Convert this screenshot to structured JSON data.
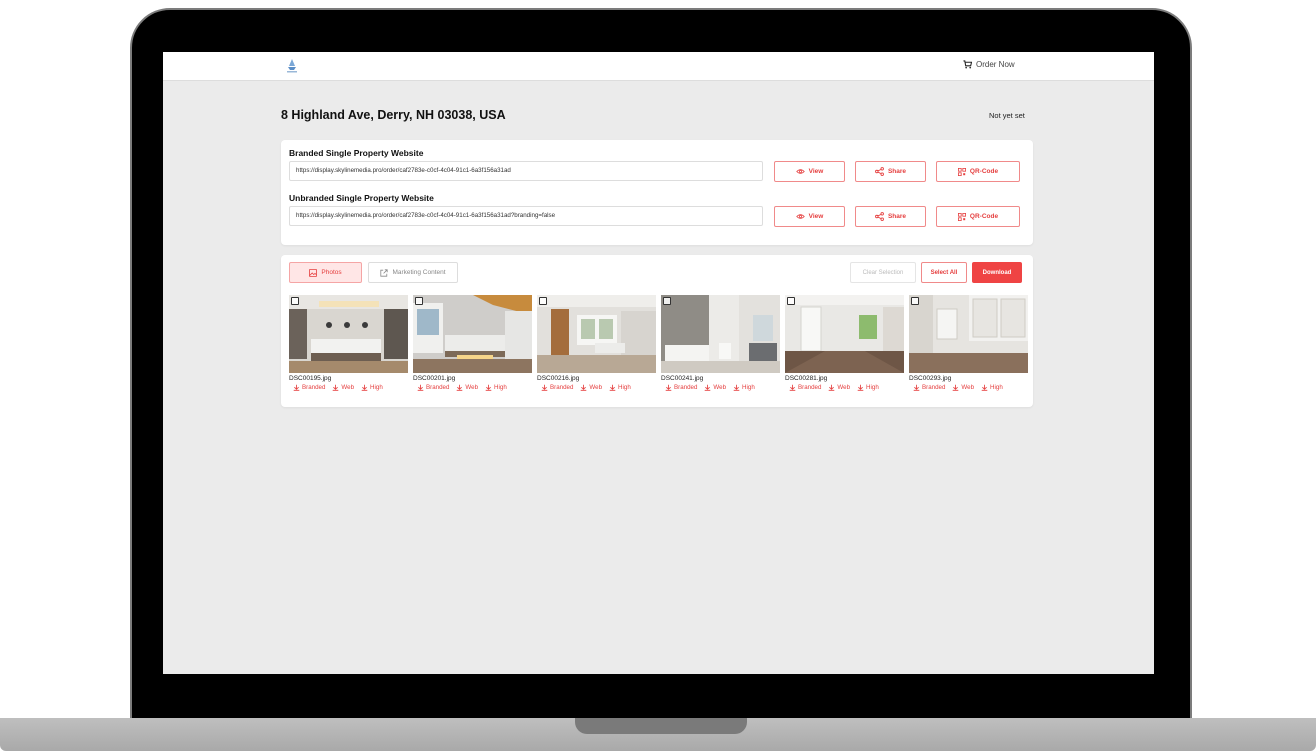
{
  "nav": {
    "order_now": "Order Now"
  },
  "property": {
    "address": "8 Highland Ave, Derry, NH 03038, USA",
    "status": "Not yet set"
  },
  "links": [
    {
      "title": "Branded Single Property Website",
      "url": "https://display.skylinemedia.pro/order/caf2783e-c0cf-4c04-91c1-6a3f156a31ad",
      "view": "View",
      "share": "Share",
      "qr": "QR-Code"
    },
    {
      "title": "Unbranded Single Property Website",
      "url": "https://display.skylinemedia.pro/order/caf2783e-c0cf-4c04-91c1-6a3f156a31ad?branding=false",
      "view": "View",
      "share": "Share",
      "qr": "QR-Code"
    }
  ],
  "gallery": {
    "tab_photos": "Photos",
    "tab_marketing": "Marketing Content",
    "clear_selection": "Clear Selection",
    "select_all": "Select All",
    "download": "Download",
    "photos": [
      {
        "filename": "DSC00195.jpg",
        "branded": "Branded",
        "web": "Web",
        "high": "High"
      },
      {
        "filename": "DSC00201.jpg",
        "branded": "Branded",
        "web": "Web",
        "high": "High"
      },
      {
        "filename": "DSC00216.jpg",
        "branded": "Branded",
        "web": "Web",
        "high": "High"
      },
      {
        "filename": "DSC00241.jpg",
        "branded": "Branded",
        "web": "Web",
        "high": "High"
      },
      {
        "filename": "DSC00281.jpg",
        "branded": "Branded",
        "web": "Web",
        "high": "High"
      },
      {
        "filename": "DSC00293.jpg",
        "branded": "Branded",
        "web": "Web",
        "high": "High"
      }
    ]
  },
  "colors": {
    "accent": "#ef4444",
    "page_bg": "#ebebeb"
  },
  "icons": [
    "shopping-cart-icon",
    "eye-icon",
    "share-icon",
    "qr-code-icon",
    "image-icon",
    "external-link-icon",
    "download-icon"
  ]
}
